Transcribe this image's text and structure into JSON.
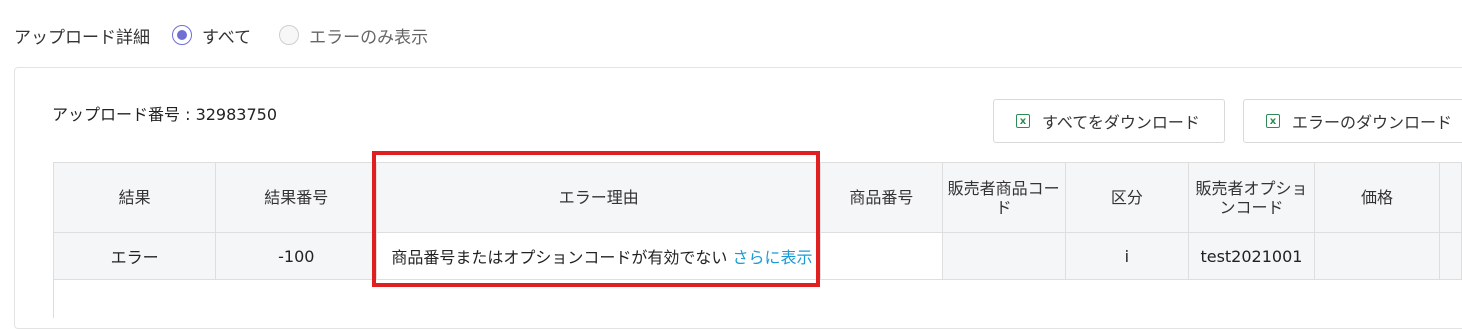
{
  "filter": {
    "label": "アップロード詳細",
    "options": [
      {
        "label": "すべて",
        "selected": true
      },
      {
        "label": "エラーのみ表示",
        "selected": false
      }
    ]
  },
  "upload": {
    "number_text": "アップロード番号 : 32983750"
  },
  "buttons": {
    "download_all": "すべてをダウンロード",
    "download_errors": "エラーのダウンロード",
    "excel_glyph": "x"
  },
  "table": {
    "headers": [
      "結果",
      "結果番号",
      "エラー理由",
      "商品番号",
      "販売者商品コード",
      "区分",
      "販売者オプションコード",
      "価格",
      ""
    ],
    "rows": [
      {
        "result": "エラー",
        "result_no": "-100",
        "error_reason": "商品番号またはオプションコードが有効でない",
        "more_link": "さらに表示",
        "product_no": "",
        "seller_code": "",
        "category": "i",
        "seller_option_code": "test2021001",
        "price": ""
      }
    ]
  },
  "colors": {
    "accent": "#6f6fd6",
    "link": "#1a9bd7",
    "highlight": "#e02020",
    "excel": "#2e8b57"
  }
}
